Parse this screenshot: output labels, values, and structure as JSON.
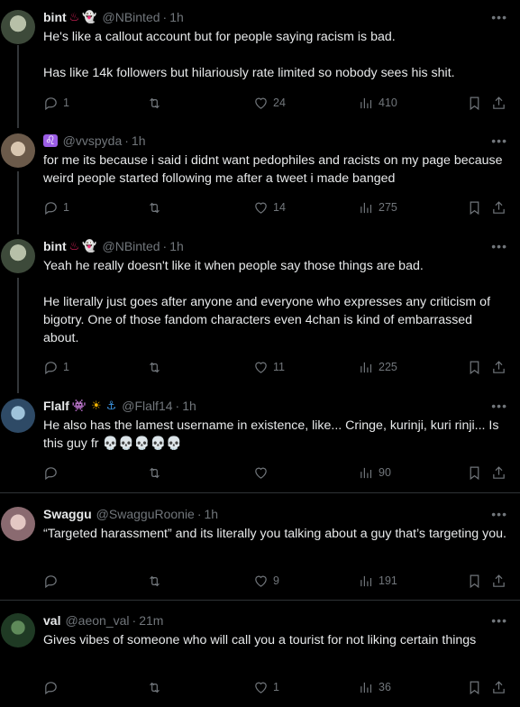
{
  "tweets": [
    {
      "name": "bint",
      "emoji": [
        "♨",
        "👻"
      ],
      "handle": "@NBinted",
      "time": "1h",
      "text": "He's like a callout account but for people saying racism is bad.\n\nHas like 14k followers but hilariously rate limited so nobody sees his shit.",
      "replies": "1",
      "retweets": "",
      "likes": "24",
      "views": "410",
      "avatar_color": "#3d4a3a"
    },
    {
      "name": "",
      "emoji": [
        "♌"
      ],
      "handle": "@vvspyda",
      "time": "1h",
      "text": "for me its because i said i didnt want pedophiles and racists on my page because weird people started following me after a tweet i made banged",
      "replies": "1",
      "retweets": "",
      "likes": "14",
      "views": "275",
      "avatar_color": "#6b5a4a"
    },
    {
      "name": "bint",
      "emoji": [
        "♨",
        "👻"
      ],
      "handle": "@NBinted",
      "time": "1h",
      "text": "Yeah he really doesn't like it when people say those things are bad.\n\nHe literally just goes after anyone and everyone who expresses any criticism of bigotry. One of those fandom characters even 4chan is kind of embarrassed about.",
      "replies": "1",
      "retweets": "",
      "likes": "11",
      "views": "225",
      "avatar_color": "#3d4a3a"
    },
    {
      "name": "Flalf",
      "emoji": [
        "👾",
        "☀",
        "⚓"
      ],
      "handle": "@Flalf14",
      "time": "1h",
      "text": "He also has the lamest username in existence, like... Cringe, kurinji, kuri rinji... Is this guy fr 💀💀💀💀💀",
      "replies": "",
      "retweets": "",
      "likes": "",
      "views": "90",
      "avatar_color": "#2e4a66"
    },
    {
      "name": "Swaggu",
      "emoji": [],
      "handle": "@SwagguRoonie",
      "time": "1h",
      "text": "“Targeted harassment” and its literally you talking about a guy that’s targeting you.",
      "replies": "",
      "retweets": "",
      "likes": "9",
      "views": "191",
      "avatar_color": "#8a6a70"
    },
    {
      "name": "val",
      "emoji": [],
      "handle": "@aeon_val",
      "time": "21m",
      "text": "Gives vibes of someone who will call you a tourist for not liking certain things",
      "replies": "",
      "retweets": "",
      "likes": "1",
      "views": "36",
      "avatar_color": "#1f3a24"
    }
  ],
  "icons": {
    "reply": "reply-icon",
    "retweet": "retweet-icon",
    "like": "heart-icon",
    "views": "views-icon",
    "bookmark": "bookmark-icon",
    "share": "share-icon",
    "more": "more-icon"
  }
}
